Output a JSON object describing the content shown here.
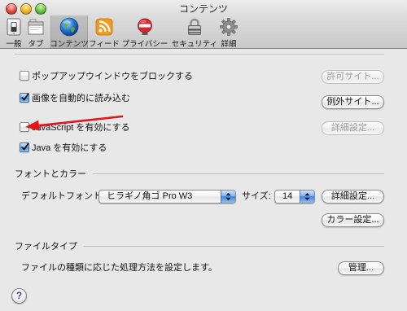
{
  "window": {
    "title": "コンテンツ"
  },
  "toolbar": {
    "items": [
      {
        "label": "一般",
        "icon": "general-switch-icon",
        "selected": false
      },
      {
        "label": "タブ",
        "icon": "tabs-icon",
        "selected": false
      },
      {
        "label": "コンテンツ",
        "icon": "globe-icon",
        "selected": true
      },
      {
        "label": "フィード",
        "icon": "rss-feed-icon",
        "selected": false
      },
      {
        "label": "プライバシー",
        "icon": "privacy-hand-icon",
        "selected": false
      },
      {
        "label": "セキュリティ",
        "icon": "padlock-icon",
        "selected": false
      },
      {
        "label": "詳細",
        "icon": "gear-icon",
        "selected": false
      }
    ]
  },
  "web_content": {
    "block_popups": {
      "label": "ポップアップウインドウをブロックする",
      "checked": false,
      "button_label": "許可サイト...",
      "button_enabled": false
    },
    "load_images": {
      "label": "画像を自動的に読み込む",
      "checked": true,
      "button_label": "例外サイト...",
      "button_enabled": true
    },
    "javascript": {
      "label": "JavaScript を有効にする",
      "checked": false,
      "button_label": "詳細設定...",
      "button_enabled": false
    },
    "java": {
      "label": "Java を有効にする",
      "checked": true
    }
  },
  "fonts_colors": {
    "heading": "フォントとカラー",
    "default_font_label": "デフォルトフォント:",
    "default_font_value": "ヒラギノ角ゴ Pro W3",
    "size_label": "サイズ:",
    "size_value": "14",
    "advanced_button_label": "詳細設定...",
    "colors_button_label": "カラー設定..."
  },
  "file_types": {
    "heading": "ファイルタイプ",
    "description": "ファイルの種類に応じた処理方法を設定します。",
    "manage_button_label": "管理..."
  },
  "help": {
    "label": "?"
  },
  "theme": {
    "accent": "#4d8fe0",
    "annotation_arrow": "#e3151b"
  }
}
